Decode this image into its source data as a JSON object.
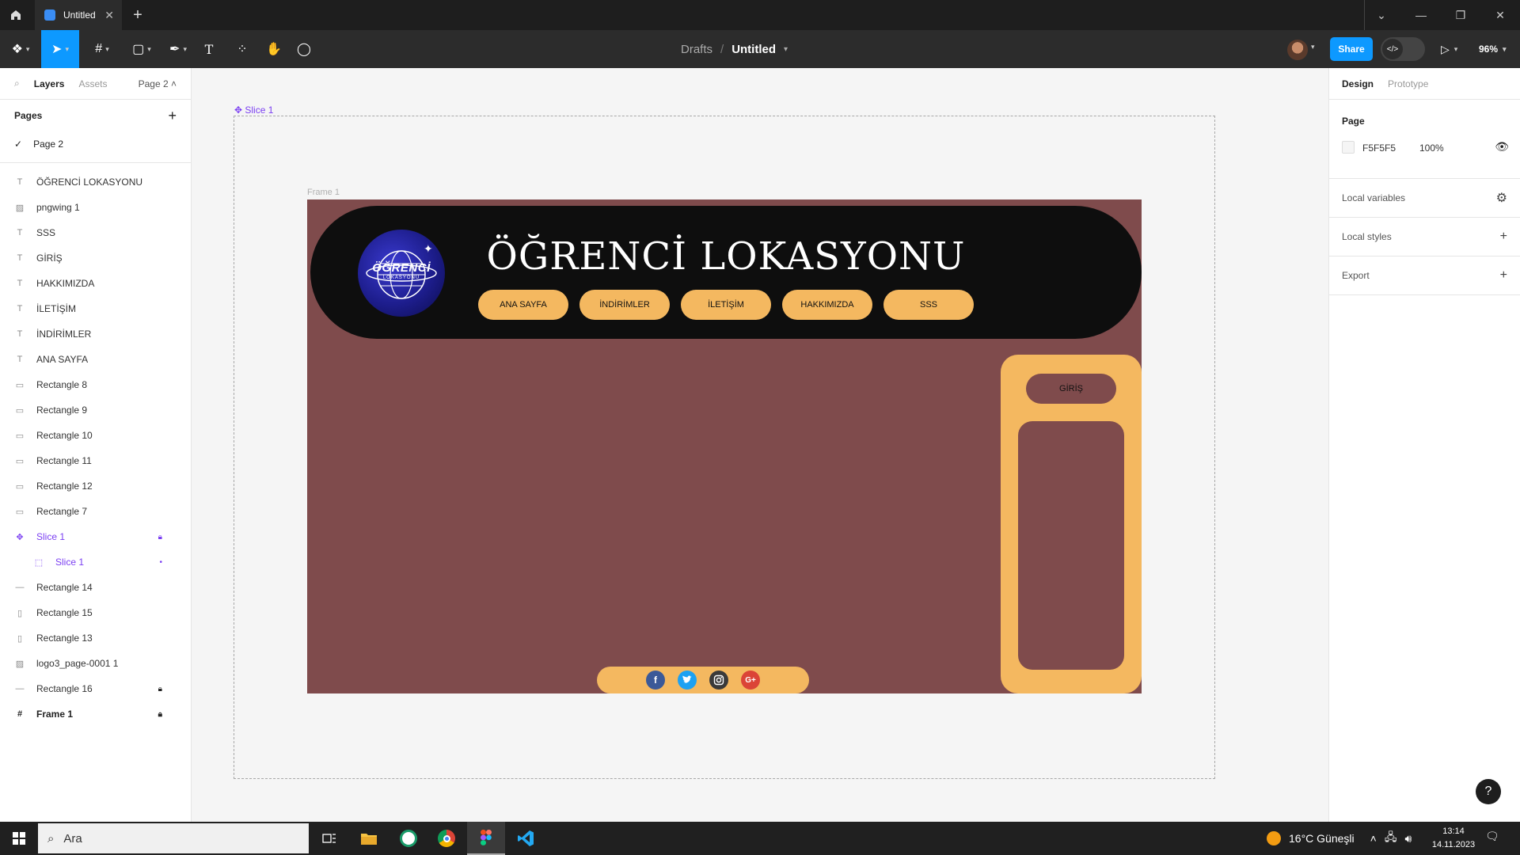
{
  "browser_tab": {
    "title": "Untitled"
  },
  "toolbar": {
    "breadcrumb_parent": "Drafts",
    "breadcrumb_sep": "/",
    "file_title": "Untitled",
    "share_label": "Share",
    "zoom": "96%"
  },
  "left_panel": {
    "tabs": {
      "layers": "Layers",
      "assets": "Assets",
      "page_selector": "Page 2"
    },
    "pages_header": "Pages",
    "pages": [
      {
        "label": "Page 2",
        "selected": true
      }
    ],
    "layers": [
      {
        "label": "ÖĞRENCİ LOKASYONU",
        "icon": "text-icon"
      },
      {
        "label": "pngwing 1",
        "icon": "image-icon"
      },
      {
        "label": "SSS",
        "icon": "text-icon"
      },
      {
        "label": "GİRİŞ",
        "icon": "text-icon"
      },
      {
        "label": "HAKKIMIZDA",
        "icon": "text-icon"
      },
      {
        "label": "İLETİŞİM",
        "icon": "text-icon"
      },
      {
        "label": "İNDİRİMLER",
        "icon": "text-icon"
      },
      {
        "label": "ANA SAYFA",
        "icon": "text-icon"
      },
      {
        "label": "Rectangle 8",
        "icon": "rectangle-icon"
      },
      {
        "label": "Rectangle 9",
        "icon": "rectangle-icon"
      },
      {
        "label": "Rectangle 10",
        "icon": "rectangle-icon"
      },
      {
        "label": "Rectangle 11",
        "icon": "rectangle-icon"
      },
      {
        "label": "Rectangle 12",
        "icon": "rectangle-icon"
      },
      {
        "label": "Rectangle 7",
        "icon": "rectangle-icon"
      },
      {
        "label": "Slice 1",
        "icon": "slice-icon",
        "locked": true
      },
      {
        "label": "Slice 1",
        "icon": "slice-icon"
      },
      {
        "label": "Rectangle 14",
        "icon": "line-icon"
      },
      {
        "label": "Rectangle 15",
        "icon": "vertical-rect-icon"
      },
      {
        "label": "Rectangle 13",
        "icon": "vertical-rect-icon"
      },
      {
        "label": "logo3_page-0001 1",
        "icon": "image-icon"
      },
      {
        "label": "Rectangle 16",
        "icon": "line-icon",
        "locked": true
      },
      {
        "label": "Frame 1",
        "icon": "frame-icon",
        "locked": true
      }
    ]
  },
  "right_panel": {
    "tabs": {
      "design": "Design",
      "prototype": "Prototype"
    },
    "page_label": "Page",
    "page_color_hex": "F5F5F5",
    "page_opacity": "100%",
    "local_variables": "Local variables",
    "local_styles": "Local styles",
    "export": "Export"
  },
  "canvas": {
    "slice_label": "Slice 1",
    "frame_label": "Frame 1",
    "site": {
      "title": "ÖĞRENCİ LOKASYONU",
      "logo_text_main": "ÖĞRENCİ",
      "logo_text_sub": "LOKASYONU",
      "nav": [
        "ANA SAYFA",
        "İNDİRİMLER",
        "İLETİŞİM",
        "HAKKIMIZDA",
        "SSS"
      ],
      "login": "GİRİŞ",
      "social": [
        "f",
        "t",
        "ig",
        "G+"
      ],
      "colors": {
        "background": "#7f4b4c",
        "accent": "#f4b860",
        "header": "#0e0e0e"
      }
    }
  },
  "taskbar": {
    "search_placeholder": "Ara",
    "weather": "16°C  Güneşli",
    "time": "13:14",
    "date": "14.11.2023"
  }
}
